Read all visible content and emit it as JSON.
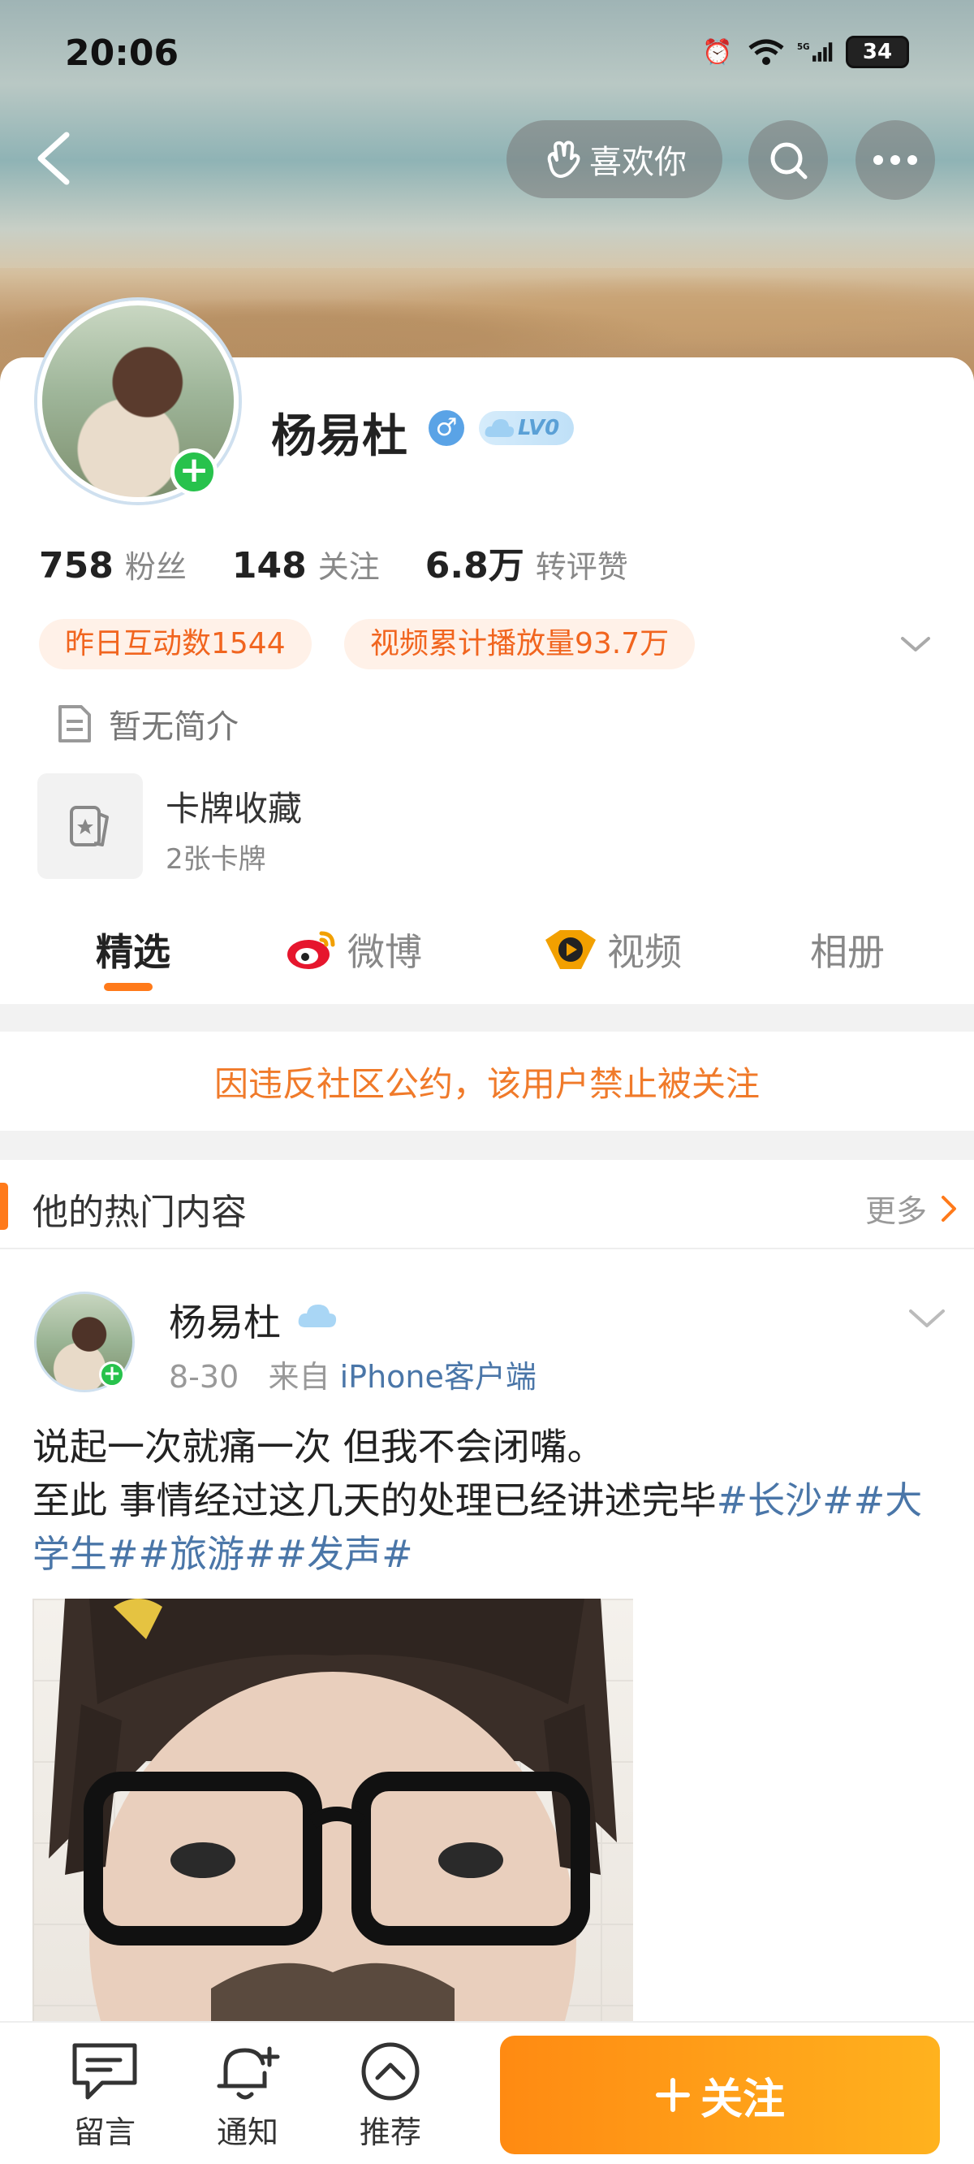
{
  "status_bar": {
    "time": "20:06",
    "battery": "34",
    "network": "5G"
  },
  "header": {
    "like_label": "喜欢你"
  },
  "profile": {
    "name": "杨易杜",
    "gender": "♂",
    "level": "LV0",
    "stats": [
      {
        "value": "758",
        "label": "粉丝"
      },
      {
        "value": "148",
        "label": "关注"
      },
      {
        "value": "6.8万",
        "label": "转评赞"
      }
    ],
    "pills": [
      "昨日互动数1544",
      "视频累计播放量93.7万"
    ],
    "intro": "暂无简介",
    "cards": {
      "title": "卡牌收藏",
      "subtitle": "2张卡牌"
    }
  },
  "tabs": [
    {
      "label": "精选",
      "active": true
    },
    {
      "label": "微博",
      "icon": "weibo-icon"
    },
    {
      "label": "视频",
      "icon": "video-icon"
    },
    {
      "label": "相册"
    }
  ],
  "notice": "因违反社区公约，该用户禁止被关注",
  "hot_section": {
    "title": "他的热门内容",
    "more": "更多"
  },
  "post": {
    "author": "杨易杜",
    "date": "8-30",
    "source_prefix": "来自",
    "source": "iPhone客户端",
    "line1": "说起一次就痛一次 但我不会闭嘴。",
    "line2": "至此 事情经过这几天的处理已经讲述完毕",
    "tags": "#长沙##大学生##旅游##发声#"
  },
  "bottom_bar": {
    "items": [
      {
        "label": "留言",
        "icon": "message-icon"
      },
      {
        "label": "通知",
        "icon": "bell-icon"
      },
      {
        "label": "推荐",
        "icon": "recommend-icon"
      }
    ],
    "follow": "关注"
  },
  "colors": {
    "accent": "#ff7a1a",
    "link": "#4a76a8",
    "notice": "#f07a2a"
  }
}
